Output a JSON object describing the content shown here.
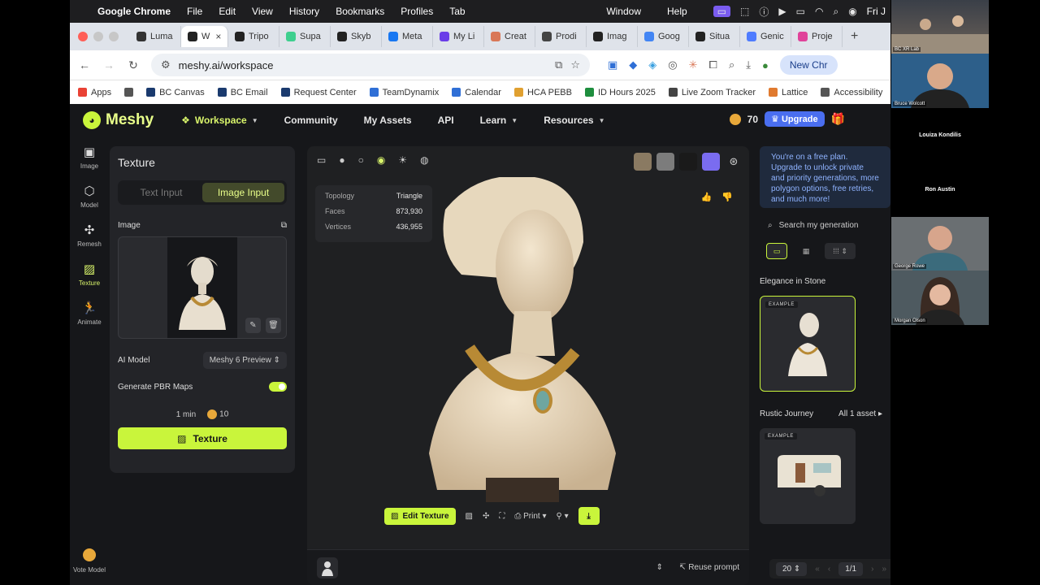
{
  "macos": {
    "app_name": "Google Chrome",
    "menus": [
      "File",
      "Edit",
      "View",
      "History",
      "Bookmarks",
      "Profiles",
      "Tab"
    ],
    "right_menus": [
      "Window",
      "Help"
    ],
    "clock": "Fri J"
  },
  "chrome": {
    "tabs": [
      {
        "label": "Luma",
        "color": "#333333"
      },
      {
        "label": "W",
        "color": "#222222",
        "active": true
      },
      {
        "label": "Tripo",
        "color": "#222222"
      },
      {
        "label": "Supa",
        "color": "#3ecf8e"
      },
      {
        "label": "Skyb",
        "color": "#222222"
      },
      {
        "label": "Meta",
        "color": "#1877f2"
      },
      {
        "label": "My Li",
        "color": "#6a3de8"
      },
      {
        "label": "Creat",
        "color": "#d97757"
      },
      {
        "label": "Prodi",
        "color": "#444444"
      },
      {
        "label": "Imag",
        "color": "#222222"
      },
      {
        "label": "Goog",
        "color": "#4285f4"
      },
      {
        "label": "Situa",
        "color": "#222222"
      },
      {
        "label": "Genic",
        "color": "#4f7cff"
      },
      {
        "label": "Proje",
        "color": "#e0439a"
      }
    ],
    "url": "meshy.ai/workspace",
    "new_chrome": "New Chr",
    "bookmarks": [
      {
        "label": "Apps",
        "color": "#e94235"
      },
      {
        "label": "",
        "color": "#555555"
      },
      {
        "label": "BC Canvas",
        "color": "#1a3a6e"
      },
      {
        "label": "BC Email",
        "color": "#1a3a6e"
      },
      {
        "label": "Request Center",
        "color": "#1a3a6e"
      },
      {
        "label": "TeamDynamix",
        "color": "#2f6fd6"
      },
      {
        "label": "Calendar",
        "color": "#2f6fd6"
      },
      {
        "label": "HCA PEBB",
        "color": "#e0a030"
      },
      {
        "label": "ID Hours 2025",
        "color": "#1e8e3e"
      },
      {
        "label": "Live Zoom Tracker",
        "color": "#444444"
      },
      {
        "label": "Lattice",
        "color": "#e07a2f"
      },
      {
        "label": "Accessibility",
        "color": "#555555"
      }
    ]
  },
  "meshy": {
    "logo": "Meshy",
    "nav": {
      "workspace": "Workspace",
      "community": "Community",
      "my_assets": "My Assets",
      "api": "API",
      "learn": "Learn",
      "resources": "Resources"
    },
    "credits": "70",
    "upgrade": "Upgrade",
    "rail": [
      {
        "label": "Image",
        "glyph": "▣"
      },
      {
        "label": "Model",
        "glyph": "⬡"
      },
      {
        "label": "Remesh",
        "glyph": "✣"
      },
      {
        "label": "Texture",
        "glyph": "▨",
        "active": true
      },
      {
        "label": "Animate",
        "glyph": "🏃"
      }
    ],
    "vote": "Vote Model",
    "panel": {
      "title": "Texture",
      "text_input": "Text Input",
      "image_input": "Image Input",
      "image_label": "Image",
      "ai_model_label": "AI Model",
      "ai_model_value": "Meshy 6 Preview",
      "pbr_label": "Generate PBR Maps",
      "time": "1 min",
      "cost": "10",
      "texture_button": "Texture"
    },
    "viewer": {
      "stats": [
        {
          "label": "Topology",
          "value": "Triangle"
        },
        {
          "label": "Faces",
          "value": "873,930"
        },
        {
          "label": "Vertices",
          "value": "436,955"
        }
      ],
      "swatch_colors": [
        "#8a7a62",
        "#7c7c7c",
        "#1a1a1a",
        "#7a6cf0"
      ],
      "edit_texture": "Edit Texture",
      "print": "Print",
      "reuse_prompt": "Reuse prompt"
    },
    "right": {
      "notice": "You're on a free plan. Upgrade to unlock private and priority generations, more polygon options, free retries, and much more!",
      "search_placeholder": "Search my generation",
      "group1": "Elegance in Stone",
      "group2": "Rustic Journey",
      "all_assets": "All 1 asset",
      "example": "EXAMPLE",
      "page_size": "20",
      "page": "1/1"
    }
  },
  "video": {
    "tiles": [
      {
        "label": "BC XR Lab"
      },
      {
        "label": "Bruce Wolcott"
      },
      {
        "label": "Louiza Kondilis"
      },
      {
        "label": "Ron Austin"
      },
      {
        "label": "George Rowe"
      },
      {
        "label": "Morgan Olson"
      }
    ]
  }
}
